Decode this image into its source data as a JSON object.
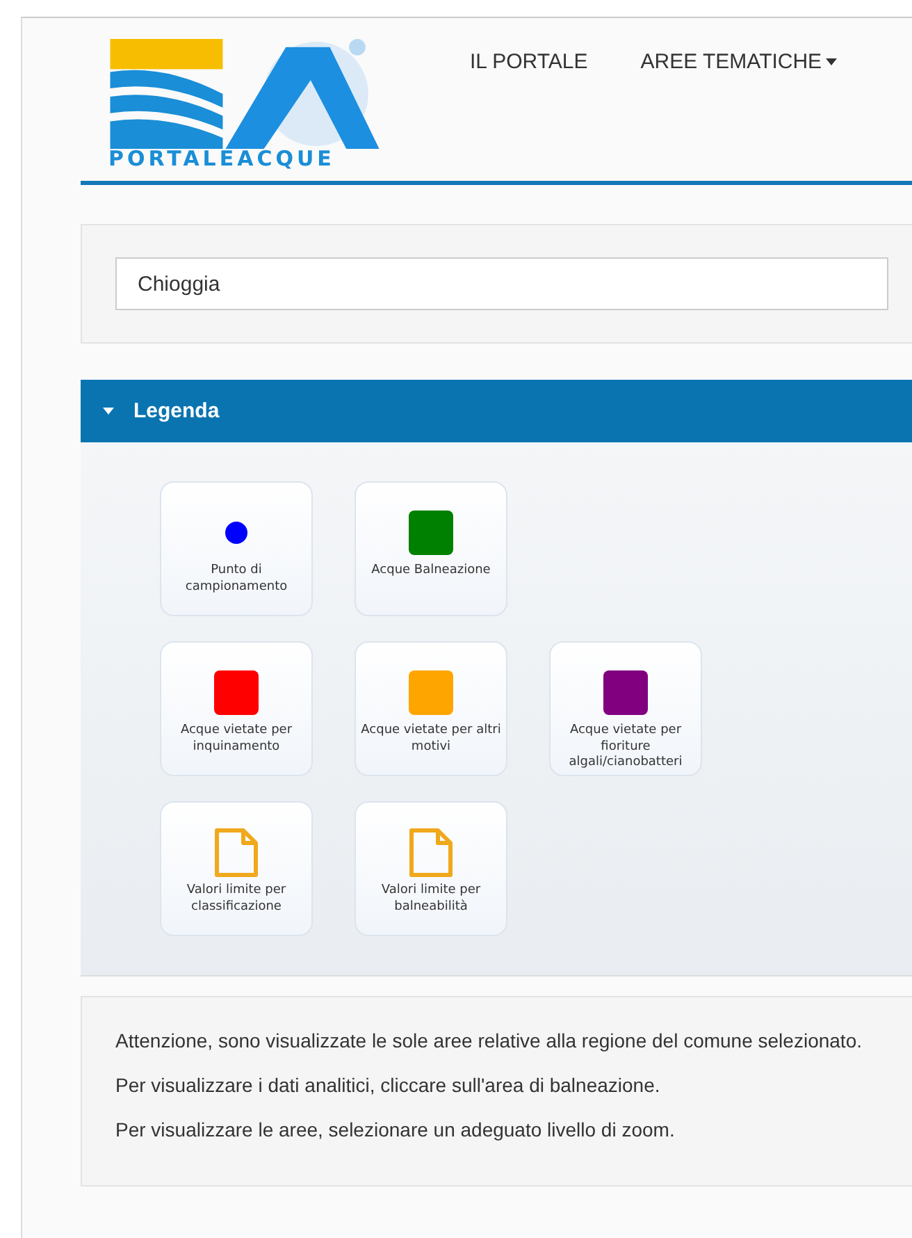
{
  "header": {
    "logo_text": "PORTALEACQUE",
    "nav": [
      {
        "label": "IL PORTALE",
        "dropdown": false
      },
      {
        "label": "AREE TEMATICHE",
        "dropdown": true
      }
    ]
  },
  "search": {
    "value": "Chioggia"
  },
  "legend": {
    "title": "Legenda",
    "expanded": true,
    "rows": [
      [
        {
          "kind": "dot",
          "color": "#0000ff",
          "label": "Punto di campionamento"
        },
        {
          "kind": "square",
          "color": "#008000",
          "label": "Acque Balneazione"
        }
      ],
      [
        {
          "kind": "square",
          "color": "#ff0000",
          "label": "Acque vietate per inquinamento"
        },
        {
          "kind": "square",
          "color": "#ffa500",
          "label": "Acque vietate per altri motivi"
        },
        {
          "kind": "square",
          "color": "#800080",
          "label": "Acque vietate per fioriture algali/cianobatteri"
        }
      ],
      [
        {
          "kind": "document",
          "label": "Valori limite per classificazione"
        },
        {
          "kind": "document",
          "label": "Valori limite per balneabilità"
        }
      ]
    ]
  },
  "notes": [
    "Attenzione, sono visualizzate le sole aree relative alla regione del comune selezionato.",
    "Per visualizzare i dati analitici, cliccare sull'area di balneazione.",
    "Per visualizzare le aree, selezionare un adeguato livello di zoom."
  ]
}
